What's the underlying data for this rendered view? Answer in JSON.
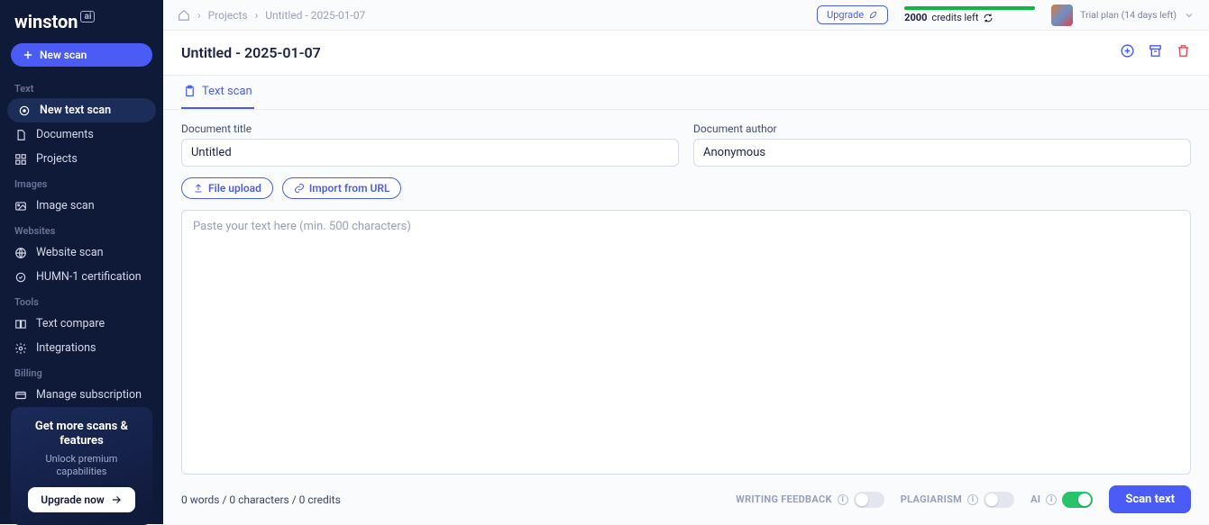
{
  "logo": {
    "name": "winston",
    "suffix": "ai"
  },
  "sidebar": {
    "new_scan": "New scan",
    "sections": {
      "text": "Text",
      "images": "Images",
      "websites": "Websites",
      "tools": "Tools",
      "billing": "Billing"
    },
    "items": {
      "new_text_scan": "New text scan",
      "documents": "Documents",
      "projects": "Projects",
      "image_scan": "Image scan",
      "website_scan": "Website scan",
      "humn1": "HUMN-1 certification",
      "text_compare": "Text compare",
      "integrations": "Integrations",
      "manage_sub": "Manage subscription"
    },
    "promo": {
      "title": "Get more scans & features",
      "sub": "Unlock premium capabilities",
      "cta": "Upgrade now"
    }
  },
  "topbar": {
    "breadcrumb_projects": "Projects",
    "breadcrumb_current": "Untitled - 2025-01-07",
    "upgrade": "Upgrade",
    "credits_number": "2000",
    "credits_suffix": "credits left",
    "trial": "Trial plan (14 days left)"
  },
  "titlebar": {
    "title": "Untitled - 2025-01-07"
  },
  "tabs": {
    "text_scan": "Text scan"
  },
  "fields": {
    "title_label": "Document title",
    "title_value": "Untitled",
    "author_label": "Document author",
    "author_value": "Anonymous"
  },
  "buttons": {
    "file_upload": "File upload",
    "import_url": "Import from URL",
    "scan_text": "Scan text"
  },
  "textarea": {
    "placeholder": "Paste your text here (min. 500 characters)"
  },
  "footer": {
    "stats": "0 words / 0 characters / 0 credits"
  },
  "toggles": {
    "writing": "WRITING FEEDBACK",
    "plagiarism": "PLAGIARISM",
    "ai": "AI"
  }
}
